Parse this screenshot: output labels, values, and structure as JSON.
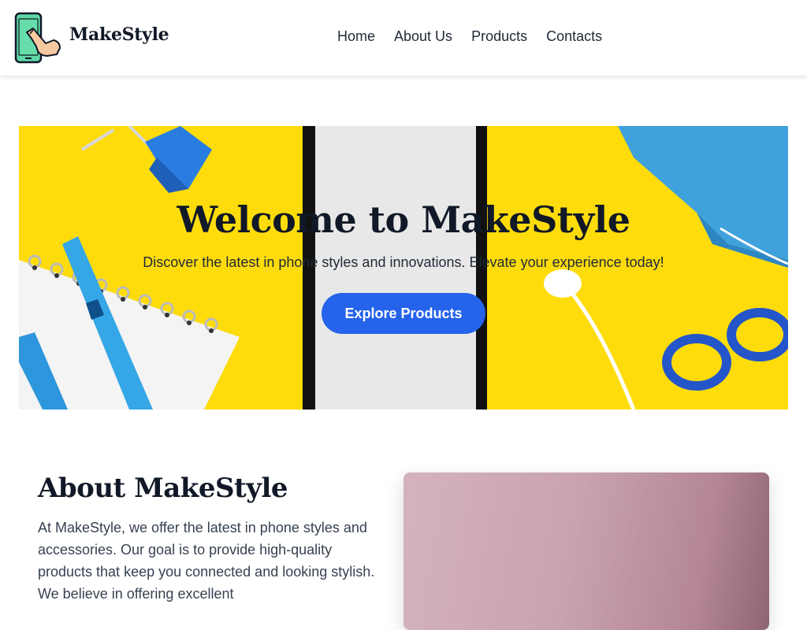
{
  "brand": {
    "name": "MakeStyle",
    "logo_icon": "phone-touch-icon"
  },
  "nav": {
    "items": [
      {
        "label": "Home"
      },
      {
        "label": "About Us"
      },
      {
        "label": "Products"
      },
      {
        "label": "Contacts"
      }
    ]
  },
  "hero": {
    "title": "Welcome to MakeStyle",
    "subtitle": "Discover the latest in phone styles and innovations. Elevate your experience today!",
    "cta_label": "Explore Products",
    "background_color": "#fedc0b",
    "cta_color": "#2563eb"
  },
  "about": {
    "title": "About MakeStyle",
    "text": "At MakeStyle, we offer the latest in phone styles and accessories. Our goal is to provide high-quality products that keep you connected and looking stylish. We believe in offering excellent"
  }
}
